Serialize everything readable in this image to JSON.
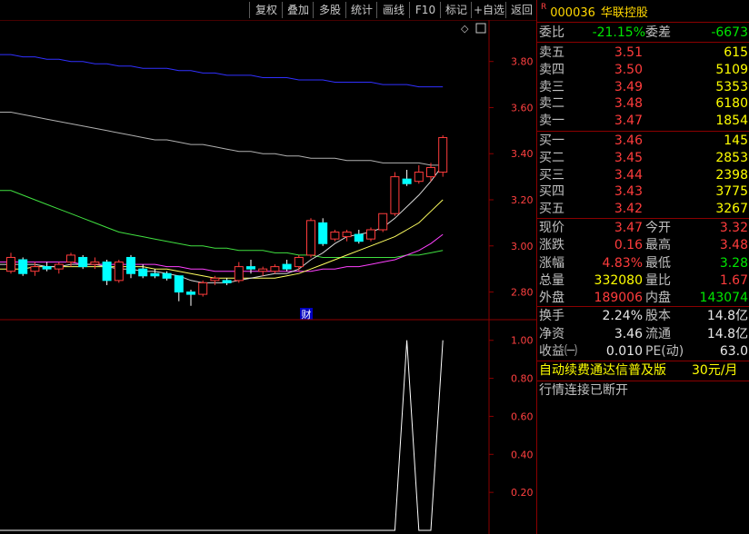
{
  "toolbar": {
    "buttons": [
      "复权",
      "叠加",
      "多股",
      "统计",
      "画线",
      "F10",
      "标记",
      "+自选",
      "返回"
    ]
  },
  "chart": {
    "price_ticks": [
      "3.80",
      "3.60",
      "3.40",
      "3.20",
      "3.00",
      "2.80"
    ],
    "indicator_ticks": [
      "1.00",
      "0.80",
      "0.60",
      "0.40",
      "0.20"
    ],
    "finance_badge": "财",
    "diamond_glyph": "◇",
    "colors": {
      "up": "#ff3c3c",
      "down": "#00ffff",
      "ma_white": "#d8d8d8",
      "ma_yellow": "#ffff60",
      "ma_magenta": "#ff40ff",
      "ma_green": "#40e040",
      "ma_gray": "#b0b0b0",
      "ma_blue": "#3030ff",
      "axis": "#8b0000"
    }
  },
  "quote": {
    "badge": "R",
    "code": "000036",
    "name": "华联控股",
    "weibi": {
      "label": "委比",
      "value": "-21.15%",
      "label2": "委差",
      "value2": "-6673"
    },
    "asks": [
      {
        "label": "卖五",
        "price": "3.51",
        "vol": "615"
      },
      {
        "label": "卖四",
        "price": "3.50",
        "vol": "5109"
      },
      {
        "label": "卖三",
        "price": "3.49",
        "vol": "5353"
      },
      {
        "label": "卖二",
        "price": "3.48",
        "vol": "6180"
      },
      {
        "label": "卖一",
        "price": "3.47",
        "vol": "1854"
      }
    ],
    "bids": [
      {
        "label": "买一",
        "price": "3.46",
        "vol": "145"
      },
      {
        "label": "买二",
        "price": "3.45",
        "vol": "2853"
      },
      {
        "label": "买三",
        "price": "3.44",
        "vol": "2398"
      },
      {
        "label": "买四",
        "price": "3.43",
        "vol": "3775"
      },
      {
        "label": "买五",
        "price": "3.42",
        "vol": "3267"
      }
    ],
    "stats": [
      {
        "l1": "现价",
        "v1": "3.47",
        "c1": "red",
        "l2": "今开",
        "v2": "3.32",
        "c2": "red"
      },
      {
        "l1": "涨跌",
        "v1": "0.16",
        "c1": "red",
        "l2": "最高",
        "v2": "3.48",
        "c2": "red"
      },
      {
        "l1": "涨幅",
        "v1": "4.83%",
        "c1": "red",
        "l2": "最低",
        "v2": "3.28",
        "c2": "green"
      },
      {
        "l1": "总量",
        "v1": "332080",
        "c1": "yellow",
        "l2": "量比",
        "v2": "1.67",
        "c2": "red"
      },
      {
        "l1": "外盘",
        "v1": "189006",
        "c1": "red",
        "l2": "内盘",
        "v2": "143074",
        "c2": "green"
      }
    ],
    "finance": [
      {
        "l1": "换手",
        "v1": "2.24%",
        "l2": "股本",
        "v2": "14.8亿"
      },
      {
        "l1": "净资",
        "v1": "3.46",
        "l2": "流通",
        "v2": "14.8亿"
      },
      {
        "l1": "收益㈠",
        "v1": "0.010",
        "l2": "PE(动)",
        "v2": "63.0"
      }
    ],
    "promo": {
      "text": "自动续费通达信普及版",
      "price": "30元/月"
    },
    "status": "行情连接已断开"
  },
  "chart_data": {
    "type": "candlestick",
    "ylim": [
      2.68,
      3.98
    ],
    "indicator_ylim": [
      0,
      1.08
    ],
    "candles": [
      {
        "o": 2.89,
        "h": 2.97,
        "l": 2.88,
        "c": 2.95
      },
      {
        "o": 2.94,
        "h": 2.95,
        "l": 2.87,
        "c": 2.88
      },
      {
        "o": 2.89,
        "h": 2.93,
        "l": 2.87,
        "c": 2.91
      },
      {
        "o": 2.91,
        "h": 2.93,
        "l": 2.89,
        "c": 2.9
      },
      {
        "o": 2.9,
        "h": 2.93,
        "l": 2.88,
        "c": 2.92
      },
      {
        "o": 2.93,
        "h": 2.97,
        "l": 2.91,
        "c": 2.96
      },
      {
        "o": 2.95,
        "h": 2.96,
        "l": 2.9,
        "c": 2.91
      },
      {
        "o": 2.92,
        "h": 2.95,
        "l": 2.9,
        "c": 2.93
      },
      {
        "o": 2.93,
        "h": 2.94,
        "l": 2.83,
        "c": 2.85
      },
      {
        "o": 2.85,
        "h": 2.94,
        "l": 2.84,
        "c": 2.93
      },
      {
        "o": 2.95,
        "h": 2.96,
        "l": 2.86,
        "c": 2.88
      },
      {
        "o": 2.9,
        "h": 2.92,
        "l": 2.86,
        "c": 2.87
      },
      {
        "o": 2.88,
        "h": 2.9,
        "l": 2.86,
        "c": 2.87
      },
      {
        "o": 2.88,
        "h": 2.89,
        "l": 2.85,
        "c": 2.86
      },
      {
        "o": 2.87,
        "h": 2.87,
        "l": 2.76,
        "c": 2.8
      },
      {
        "o": 2.8,
        "h": 2.81,
        "l": 2.74,
        "c": 2.79
      },
      {
        "o": 2.79,
        "h": 2.85,
        "l": 2.78,
        "c": 2.84
      },
      {
        "o": 2.85,
        "h": 2.87,
        "l": 2.83,
        "c": 2.86
      },
      {
        "o": 2.85,
        "h": 2.86,
        "l": 2.83,
        "c": 2.84
      },
      {
        "o": 2.85,
        "h": 2.93,
        "l": 2.84,
        "c": 2.91
      },
      {
        "o": 2.91,
        "h": 2.94,
        "l": 2.88,
        "c": 2.9
      },
      {
        "o": 2.89,
        "h": 2.91,
        "l": 2.87,
        "c": 2.9
      },
      {
        "o": 2.89,
        "h": 2.92,
        "l": 2.88,
        "c": 2.91
      },
      {
        "o": 2.92,
        "h": 2.94,
        "l": 2.89,
        "c": 2.9
      },
      {
        "o": 2.91,
        "h": 2.96,
        "l": 2.89,
        "c": 2.95
      },
      {
        "o": 2.96,
        "h": 3.12,
        "l": 2.95,
        "c": 3.11
      },
      {
        "o": 3.1,
        "h": 3.12,
        "l": 3.0,
        "c": 3.01
      },
      {
        "o": 3.03,
        "h": 3.07,
        "l": 3.02,
        "c": 3.06
      },
      {
        "o": 3.04,
        "h": 3.07,
        "l": 3.02,
        "c": 3.06
      },
      {
        "o": 3.05,
        "h": 3.07,
        "l": 3.01,
        "c": 3.02
      },
      {
        "o": 3.03,
        "h": 3.08,
        "l": 3.02,
        "c": 3.07
      },
      {
        "o": 3.07,
        "h": 3.14,
        "l": 3.06,
        "c": 3.14
      },
      {
        "o": 3.14,
        "h": 3.32,
        "l": 3.13,
        "c": 3.3
      },
      {
        "o": 3.29,
        "h": 3.33,
        "l": 3.26,
        "c": 3.27
      },
      {
        "o": 3.28,
        "h": 3.35,
        "l": 3.27,
        "c": 3.32
      },
      {
        "o": 3.3,
        "h": 3.36,
        "l": 3.28,
        "c": 3.34
      },
      {
        "o": 3.32,
        "h": 3.48,
        "l": 3.3,
        "c": 3.47
      }
    ],
    "ma_lines": [
      {
        "color": "#d8d8d8",
        "values": [
          2.92,
          2.92,
          2.92,
          2.91,
          2.91,
          2.92,
          2.92,
          2.92,
          2.91,
          2.9,
          2.9,
          2.89,
          2.89,
          2.88,
          2.87,
          2.85,
          2.84,
          2.84,
          2.84,
          2.85,
          2.86,
          2.87,
          2.88,
          2.88,
          2.9,
          2.94,
          2.97,
          3.01,
          3.04,
          3.05,
          3.06,
          3.08,
          3.12,
          3.17,
          3.22,
          3.28,
          3.35
        ]
      },
      {
        "color": "#ffff60",
        "values": [
          2.9,
          2.9,
          2.91,
          2.91,
          2.91,
          2.91,
          2.91,
          2.91,
          2.91,
          2.91,
          2.91,
          2.91,
          2.9,
          2.9,
          2.89,
          2.88,
          2.87,
          2.86,
          2.86,
          2.86,
          2.86,
          2.86,
          2.86,
          2.87,
          2.88,
          2.9,
          2.92,
          2.94,
          2.96,
          2.98,
          3.0,
          3.02,
          3.04,
          3.07,
          3.1,
          3.15,
          3.2
        ]
      },
      {
        "color": "#ff40ff",
        "values": [
          2.93,
          2.93,
          2.93,
          2.93,
          2.93,
          2.93,
          2.92,
          2.92,
          2.92,
          2.92,
          2.92,
          2.92,
          2.92,
          2.91,
          2.91,
          2.9,
          2.9,
          2.89,
          2.89,
          2.89,
          2.89,
          2.89,
          2.89,
          2.89,
          2.89,
          2.89,
          2.9,
          2.9,
          2.91,
          2.91,
          2.92,
          2.93,
          2.94,
          2.96,
          2.98,
          3.01,
          3.05
        ]
      },
      {
        "color": "#40e040",
        "values": [
          3.24,
          3.22,
          3.2,
          3.18,
          3.16,
          3.14,
          3.12,
          3.1,
          3.08,
          3.06,
          3.05,
          3.04,
          3.03,
          3.02,
          3.01,
          3.0,
          3.0,
          2.99,
          2.99,
          2.98,
          2.98,
          2.98,
          2.97,
          2.97,
          2.96,
          2.96,
          2.95,
          2.95,
          2.95,
          2.95,
          2.95,
          2.95,
          2.95,
          2.96,
          2.96,
          2.97,
          2.98
        ]
      },
      {
        "color": "#b0b0b0",
        "values": [
          3.58,
          3.57,
          3.56,
          3.55,
          3.54,
          3.53,
          3.52,
          3.51,
          3.5,
          3.49,
          3.48,
          3.47,
          3.46,
          3.46,
          3.45,
          3.44,
          3.44,
          3.43,
          3.42,
          3.41,
          3.41,
          3.4,
          3.4,
          3.39,
          3.39,
          3.38,
          3.38,
          3.38,
          3.37,
          3.37,
          3.37,
          3.36,
          3.36,
          3.36,
          3.36,
          3.35,
          3.35
        ]
      },
      {
        "color": "#3030ff",
        "values": [
          3.83,
          3.82,
          3.82,
          3.81,
          3.81,
          3.8,
          3.8,
          3.79,
          3.79,
          3.78,
          3.78,
          3.77,
          3.77,
          3.77,
          3.76,
          3.76,
          3.75,
          3.75,
          3.74,
          3.74,
          3.74,
          3.73,
          3.73,
          3.73,
          3.72,
          3.72,
          3.72,
          3.71,
          3.71,
          3.71,
          3.71,
          3.7,
          3.7,
          3.7,
          3.69,
          3.69,
          3.69
        ]
      }
    ],
    "indicator": [
      0,
      0,
      0,
      0,
      0,
      0,
      0,
      0,
      0,
      0,
      0,
      0,
      0,
      0,
      0,
      0,
      0,
      0,
      0,
      0,
      0,
      0,
      0,
      0,
      0,
      0,
      0,
      0,
      0,
      0,
      0,
      0,
      0,
      1,
      0,
      0,
      1
    ]
  }
}
